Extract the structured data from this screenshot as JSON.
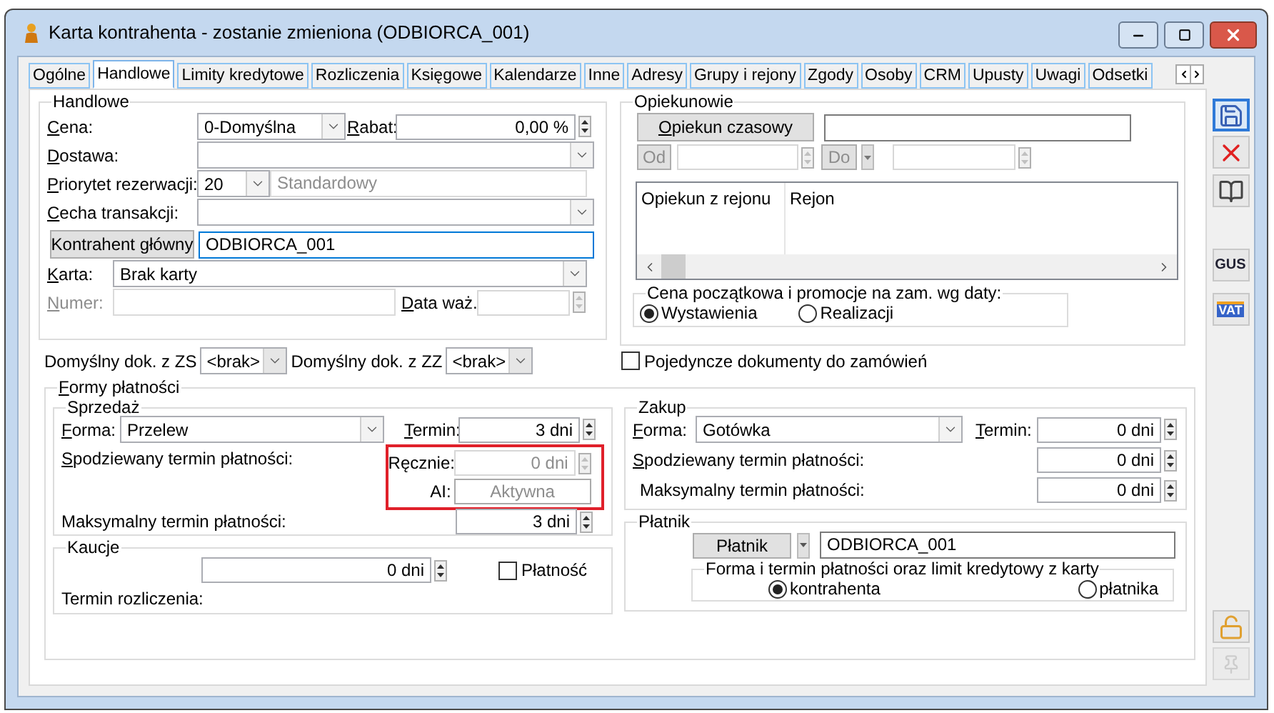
{
  "window": {
    "title": "Karta kontrahenta - zostanie zmieniona (ODBIORCA_001)"
  },
  "tabs": [
    {
      "label": "Ogólne",
      "selected": false
    },
    {
      "label": "Handlowe",
      "selected": true
    },
    {
      "label": "Limity kredytowe",
      "selected": false
    },
    {
      "label": "Rozliczenia",
      "selected": false
    },
    {
      "label": "Księgowe",
      "selected": false
    },
    {
      "label": "Kalendarze",
      "selected": false
    },
    {
      "label": "Inne",
      "selected": false
    },
    {
      "label": "Adresy",
      "selected": false
    },
    {
      "label": "Grupy i rejony",
      "selected": false
    },
    {
      "label": "Zgody",
      "selected": false
    },
    {
      "label": "Osoby",
      "selected": false
    },
    {
      "label": "CRM",
      "selected": false
    },
    {
      "label": "Upusty",
      "selected": false
    },
    {
      "label": "Uwagi",
      "selected": false
    },
    {
      "label": "Odsetki",
      "selected": false
    }
  ],
  "handlowe": {
    "title": "Handlowe",
    "cena": {
      "label": "Cena:",
      "value": "0-Domyślna"
    },
    "rabat": {
      "label": "Rabat:",
      "value": "0,00 %"
    },
    "dostawa": {
      "label": "Dostawa:"
    },
    "priorytet": {
      "label": "Priorytet rezerwacji:",
      "value": "20",
      "description": "Standardowy"
    },
    "cecha": {
      "label": "Cecha transakcji:"
    },
    "kontrahent_glowny": {
      "button": "Kontrahent główny",
      "value": "ODBIORCA_001",
      "focused": true
    },
    "karta": {
      "label": "Karta:",
      "value": "Brak karty"
    },
    "numer": {
      "label": "Numer:",
      "disabled": true
    },
    "data_waz": {
      "label": "Data waż."
    }
  },
  "opiekunowie": {
    "title": "Opiekunowie",
    "button": "Opiekun czasowy",
    "od": "Od",
    "do": "Do",
    "columns": [
      "Opiekun z rejonu",
      "Rejon"
    ],
    "price_date": {
      "title": "Cena początkowa i promocje na zam. wg daty:",
      "options": [
        {
          "label": "Wystawienia",
          "selected": true
        },
        {
          "label": "Realizacji",
          "selected": false
        }
      ]
    }
  },
  "default_docs": [
    {
      "label": "Domyślny dok. z ZS",
      "value": "<brak>"
    },
    {
      "label": "Domyślny dok. z ZZ",
      "value": "<brak>"
    }
  ],
  "single_docs": {
    "label": "Pojedyncze dokumenty do zamówień",
    "checked": false
  },
  "formy": {
    "title": "Formy płatności",
    "sprzedaz": {
      "title": "Sprzedaż",
      "forma": {
        "label": "Forma:",
        "value": "Przelew"
      },
      "termin": {
        "label": "Termin:",
        "value": "3 dni"
      },
      "expected_label": "Spodziewany termin płatności:",
      "highlighted": true,
      "manual": {
        "label": "Ręcznie:",
        "value": "0 dni",
        "disabled": true
      },
      "ai": {
        "label": "AI:",
        "value": "Aktywna",
        "disabled": true
      },
      "max": {
        "label": "Maksymalny termin płatności:",
        "value": "3 dni"
      }
    },
    "kaucje": {
      "title": "Kaucje",
      "value": "0 dni",
      "platnosc": {
        "label": "Płatność",
        "checked": false
      },
      "settlement_label": "Termin rozliczenia:"
    },
    "zakup": {
      "title": "Zakup",
      "forma": {
        "label": "Forma:",
        "value": "Gotówka"
      },
      "termin": {
        "label": "Termin:",
        "value": "0 dni"
      },
      "expected": {
        "label": "Spodziewany termin płatności:",
        "value": "0 dni"
      },
      "max": {
        "label": "Maksymalny termin płatności:",
        "value": "0 dni"
      }
    },
    "platnik": {
      "title": "Płatnik",
      "button": "Płatnik",
      "value": "ODBIORCA_001",
      "source": {
        "title": "Forma i termin płatności oraz limit kredytowy z karty",
        "options": [
          {
            "label": "kontrahenta",
            "selected": true
          },
          {
            "label": "płatnika",
            "selected": false
          }
        ]
      }
    }
  },
  "toolbar": [
    {
      "kind": "save",
      "selected": true
    },
    {
      "kind": "delete",
      "selected": false
    },
    {
      "kind": "book",
      "selected": false
    },
    {
      "kind": "gus",
      "label": "GUS",
      "selected": false
    },
    {
      "kind": "vat",
      "label": "VAT",
      "selected": false
    },
    {
      "kind": "lock",
      "selected": false
    },
    {
      "kind": "pin",
      "selected": false,
      "disabled": true
    }
  ]
}
